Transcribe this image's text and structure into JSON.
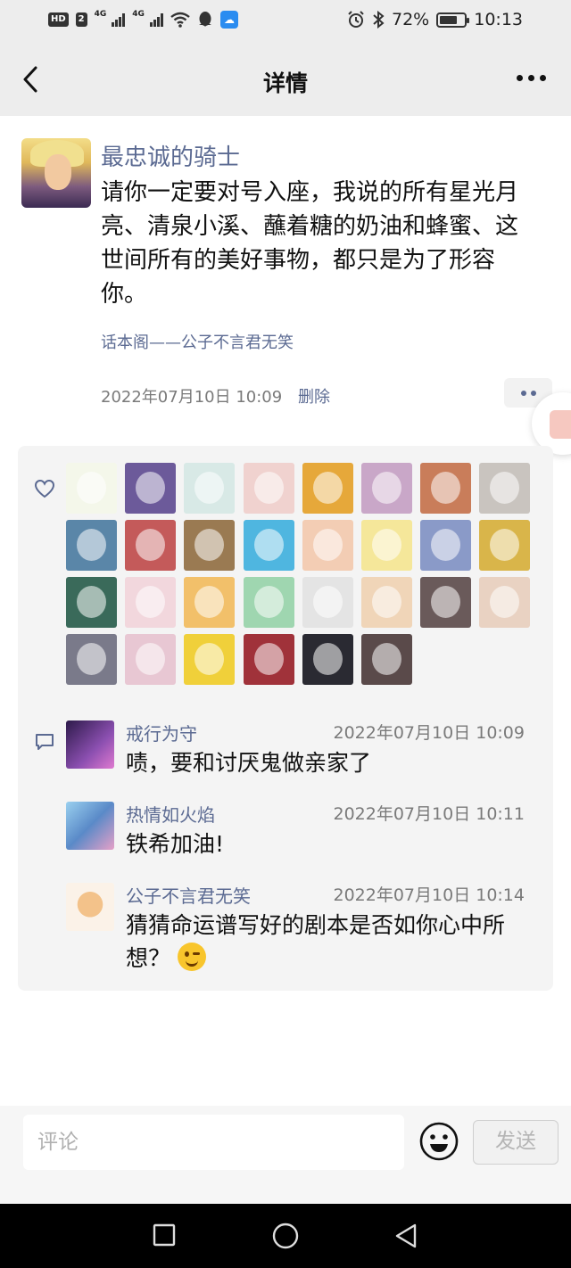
{
  "status_bar": {
    "left_chip": "HD",
    "left_chip2": "2",
    "net1": "4G",
    "net2": "4G",
    "battery_percent_text": "72%",
    "battery_level": 0.72,
    "time": "10:13"
  },
  "nav": {
    "title": "详情"
  },
  "post": {
    "author": "最忠诚的骑士",
    "text": "请你一定要对号入座，我说的所有星光月亮、清泉小溪、蘸着糖的奶油和蜂蜜、这世间所有的美好事物，都只是为了形容你。",
    "source": "话本阁——公子不言君无笑",
    "time": "2022年07月10日 10:09",
    "delete_label": "删除"
  },
  "likes": {
    "avatars": [
      {
        "name": "avatar-bunny",
        "color": "#f4f7ea"
      },
      {
        "name": "avatar-anime-girl-purple",
        "color": "#6c5a9a"
      },
      {
        "name": "avatar-teal-hair",
        "color": "#d8e9e6"
      },
      {
        "name": "avatar-girl-smile",
        "color": "#f0d2cf"
      },
      {
        "name": "avatar-cartoon-king",
        "color": "#e6a83a"
      },
      {
        "name": "avatar-dark-hair",
        "color": "#c9a7c8"
      },
      {
        "name": "avatar-couple-sunset",
        "color": "#c97d5a"
      },
      {
        "name": "avatar-astronaut-cat",
        "color": "#c9c4bf"
      },
      {
        "name": "avatar-beach",
        "color": "#5a86a8"
      },
      {
        "name": "avatar-red-dress",
        "color": "#c45a5a"
      },
      {
        "name": "avatar-warm-blur",
        "color": "#9a7a52"
      },
      {
        "name": "avatar-pink-bird",
        "color": "#4fb6e0"
      },
      {
        "name": "avatar-cartoon-boy",
        "color": "#f3cdb4"
      },
      {
        "name": "avatar-yellow-cartoon",
        "color": "#f5e79a"
      },
      {
        "name": "avatar-blue-anime",
        "color": "#8a9ac8"
      },
      {
        "name": "avatar-sponge",
        "color": "#d9b54a"
      },
      {
        "name": "avatar-miffy",
        "color": "#3a6a5a"
      },
      {
        "name": "avatar-pink-anime",
        "color": "#f2d7dd"
      },
      {
        "name": "avatar-blonde-anime",
        "color": "#f2c06a"
      },
      {
        "name": "avatar-bulbasaur",
        "color": "#9fd6b0"
      },
      {
        "name": "avatar-grey-sketch",
        "color": "#e4e4e4"
      },
      {
        "name": "avatar-chibi-couple",
        "color": "#f0d5b8"
      },
      {
        "name": "avatar-dark-cat",
        "color": "#6a5a5a"
      },
      {
        "name": "avatar-girl-long-hair",
        "color": "#e9d2c2"
      },
      {
        "name": "avatar-heart-hands",
        "color": "#7a7a8a"
      },
      {
        "name": "avatar-pretty-girl",
        "color": "#e8c7d3"
      },
      {
        "name": "avatar-dog",
        "color": "#f0d03a"
      },
      {
        "name": "avatar-red-fan",
        "color": "#a0323a"
      },
      {
        "name": "avatar-school-girl",
        "color": "#2a2a32"
      },
      {
        "name": "avatar-couple-kiss",
        "color": "#5a4a4a"
      }
    ]
  },
  "comments": [
    {
      "author": "戒行为守",
      "time": "2022年07月10日 10:09",
      "text": "啧，要和讨厌鬼做亲家了",
      "avatar_color": "#4b2a6a"
    },
    {
      "author": "热情如火焰",
      "time": "2022年07月10日 10:11",
      "text": "铁希加油!",
      "avatar_color": "#7ab0d8"
    },
    {
      "author": "公子不言君无笑",
      "time": "2022年07月10日 10:14",
      "text": "猜猜命运谱写好的剧本是否如你心中所想？",
      "avatar_color": "#f4e2d2"
    }
  ],
  "composer": {
    "placeholder": "评论",
    "send_label": "发送"
  },
  "colors": {
    "link": "#5b6a92",
    "panel": "#f4f4f4",
    "header": "#ededed"
  }
}
